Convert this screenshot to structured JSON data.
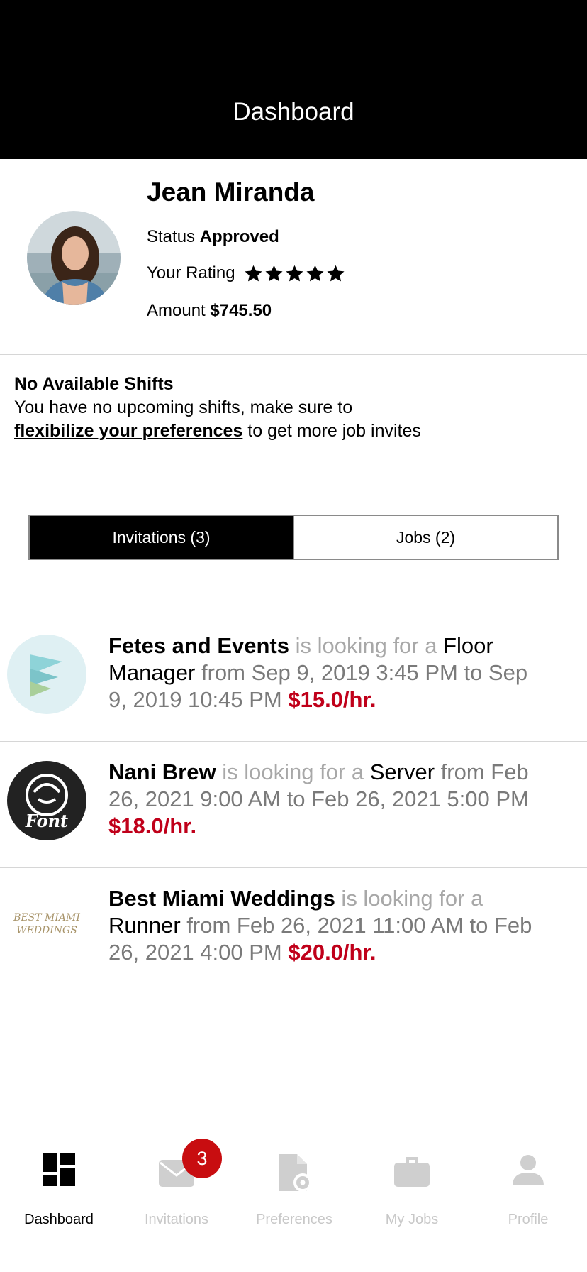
{
  "header": {
    "title": "Dashboard"
  },
  "profile": {
    "name": "Jean Miranda",
    "status_label": "Status",
    "status_value": "Approved",
    "rating_label": "Your Rating",
    "rating_value": 5,
    "rating_max": 5,
    "amount_label": "Amount",
    "amount_value": "$745.50"
  },
  "notice": {
    "title": "No Available Shifts",
    "line1": "You have no upcoming shifts, make sure to",
    "link": "flexibilize your preferences",
    "line2": " to get more job invites"
  },
  "segments": [
    {
      "label": "Invitations (3)",
      "active": true
    },
    {
      "label": "Jobs (2)",
      "active": false
    }
  ],
  "invitations": [
    {
      "company": "Fetes and Events",
      "connector": " is looking for a ",
      "role": "Floor Manager",
      "details": " from Sep 9, 2019 3:45 PM to Sep 9, 2019 10:45 PM ",
      "rate": "$15.0/hr.",
      "logo": "fetes-logo"
    },
    {
      "company": "Nani Brew",
      "connector": " is looking for a ",
      "role": "Server",
      "details": " from Feb 26, 2021 9:00 AM to Feb 26, 2021 5:00 PM ",
      "rate": "$18.0/hr.",
      "logo": "font-logo",
      "logo_text": "Font"
    },
    {
      "company": "Best Miami Weddings",
      "connector": " is looking for a ",
      "role": "Runner",
      "details": " from Feb 26, 2021 11:00 AM to Feb 26, 2021 4:00 PM ",
      "rate": "$20.0/hr.",
      "logo": "best-miami-weddings-logo",
      "logo_text": "BEST MIAMI WEDDINGS"
    }
  ],
  "tabbar": {
    "items": [
      {
        "label": "Dashboard",
        "icon": "dashboard-icon",
        "active": true
      },
      {
        "label": "Invitations",
        "icon": "envelope-icon",
        "active": false
      },
      {
        "label": "Preferences",
        "icon": "document-gear-icon",
        "active": false
      },
      {
        "label": "My Jobs",
        "icon": "briefcase-icon",
        "active": false
      },
      {
        "label": "Profile",
        "icon": "person-icon",
        "active": false
      }
    ],
    "invitations_badge": "3"
  },
  "colors": {
    "accent_red": "#c0001a",
    "badge_red": "#c80d10",
    "header_bg": "#000000"
  }
}
